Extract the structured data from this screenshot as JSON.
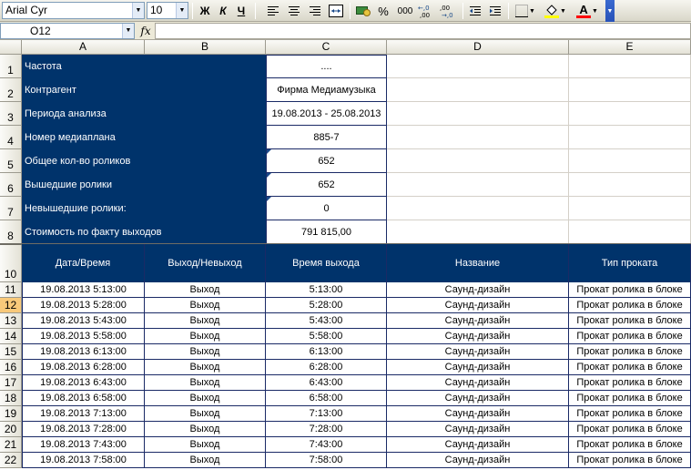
{
  "toolbar": {
    "font_name": "Arial Cyr",
    "font_size": "10",
    "bold": "Ж",
    "italic": "К",
    "underline": "Ч",
    "percent": "%",
    "thousands": "000",
    "inc_decimals": "+,0\n,00",
    "dec_decimals": ",00\n→,0",
    "font_color_letter": "A",
    "accent_fill": "#ffff00",
    "accent_font": "#ff0000"
  },
  "formula_bar": {
    "cell_ref": "O12",
    "fx": "fx",
    "formula": ""
  },
  "columns": [
    "A",
    "B",
    "C",
    "D",
    "E"
  ],
  "row_numbers": [
    "1",
    "2",
    "3",
    "4",
    "5",
    "6",
    "7",
    "8",
    "10",
    "11",
    "12",
    "13",
    "14",
    "15",
    "16",
    "17",
    "18",
    "19",
    "20",
    "21",
    "22"
  ],
  "summary": [
    {
      "label": "Частота",
      "value": "...."
    },
    {
      "label": "Контрагент",
      "value": "Фирма Медиамузыка"
    },
    {
      "label": "Периода анализа",
      "value": "19.08.2013 - 25.08.2013"
    },
    {
      "label": "Номер медиаплана",
      "value": "885-7"
    },
    {
      "label": "Общее кол-во роликов",
      "value": "652"
    },
    {
      "label": "Вышедшие ролики",
      "value": "652"
    },
    {
      "label": "Невышедшие ролики:",
      "value": "0"
    },
    {
      "label": "Стоимость по факту выходов",
      "value": "791 815,00"
    }
  ],
  "table_headers": [
    "Дата/Время",
    "Выход/Невыход",
    "Время выхода",
    "Название",
    "Тип проката"
  ],
  "table_rows": [
    [
      "19.08.2013 5:13:00",
      "Выход",
      "5:13:00",
      "Саунд-дизайн",
      "Прокат ролика в блоке"
    ],
    [
      "19.08.2013 5:28:00",
      "Выход",
      "5:28:00",
      "Саунд-дизайн",
      "Прокат ролика в блоке"
    ],
    [
      "19.08.2013 5:43:00",
      "Выход",
      "5:43:00",
      "Саунд-дизайн",
      "Прокат ролика в блоке"
    ],
    [
      "19.08.2013 5:58:00",
      "Выход",
      "5:58:00",
      "Саунд-дизайн",
      "Прокат ролика в блоке"
    ],
    [
      "19.08.2013 6:13:00",
      "Выход",
      "6:13:00",
      "Саунд-дизайн",
      "Прокат ролика в блоке"
    ],
    [
      "19.08.2013 6:28:00",
      "Выход",
      "6:28:00",
      "Саунд-дизайн",
      "Прокат ролика в блоке"
    ],
    [
      "19.08.2013 6:43:00",
      "Выход",
      "6:43:00",
      "Саунд-дизайн",
      "Прокат ролика в блоке"
    ],
    [
      "19.08.2013 6:58:00",
      "Выход",
      "6:58:00",
      "Саунд-дизайн",
      "Прокат ролика в блоке"
    ],
    [
      "19.08.2013 7:13:00",
      "Выход",
      "7:13:00",
      "Саунд-дизайн",
      "Прокат ролика в блоке"
    ],
    [
      "19.08.2013 7:28:00",
      "Выход",
      "7:28:00",
      "Саунд-дизайн",
      "Прокат ролика в блоке"
    ],
    [
      "19.08.2013 7:43:00",
      "Выход",
      "7:43:00",
      "Саунд-дизайн",
      "Прокат ролика в блоке"
    ],
    [
      "19.08.2013 7:58:00",
      "Выход",
      "7:58:00",
      "Саунд-дизайн",
      "Прокат ролика в блоке"
    ]
  ],
  "colors": {
    "header_fill": "#00336b",
    "header_text": "#ffffff",
    "active_row_header": "#f8c97a"
  }
}
